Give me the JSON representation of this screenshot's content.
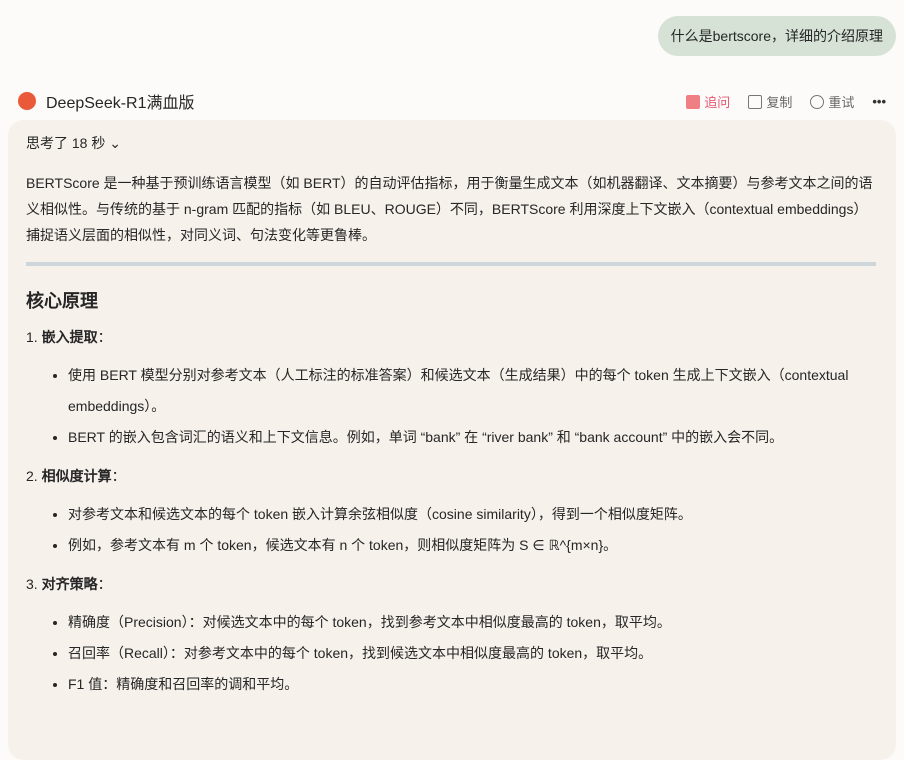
{
  "user_message": "什么是bertscore，详细的介绍原理",
  "model_name": "DeepSeek-R1满血版",
  "actions": {
    "ask": "追问",
    "copy": "复制",
    "retry": "重试",
    "more": "•••"
  },
  "thinking": "思考了 18 秒",
  "intro": "BERTScore 是一种基于预训练语言模型（如 BERT）的自动评估指标，用于衡量生成文本（如机器翻译、文本摘要）与参考文本之间的语义相似性。与传统的基于 n-gram 匹配的指标（如 BLEU、ROUGE）不同，BERTScore 利用深度上下文嵌入（contextual embeddings）捕捉语义层面的相似性，对同义词、句法变化等更鲁棒。",
  "heading": "核心原理",
  "sections": [
    {
      "num": "1.",
      "title": "嵌入提取",
      "items": [
        "使用 BERT 模型分别对参考文本（人工标注的标准答案）和候选文本（生成结果）中的每个 token 生成上下文嵌入（contextual embeddings）。",
        "BERT 的嵌入包含词汇的语义和上下文信息。例如，单词 “bank” 在 “river bank” 和 “bank account” 中的嵌入会不同。"
      ]
    },
    {
      "num": "2.",
      "title": "相似度计算",
      "items": [
        "对参考文本和候选文本的每个 token 嵌入计算余弦相似度（cosine similarity），得到一个相似度矩阵。",
        "例如，参考文本有 m 个 token，候选文本有 n 个 token，则相似度矩阵为 S ∈ ℝ^{m×n}。"
      ]
    },
    {
      "num": "3.",
      "title": "对齐策略",
      "items": [
        "精确度（Precision）：对候选文本中的每个 token，找到参考文本中相似度最高的 token，取平均。",
        "召回率（Recall）：对参考文本中的每个 token，找到候选文本中相似度最高的 token，取平均。",
        "F1 值：精确度和召回率的调和平均。"
      ]
    }
  ]
}
